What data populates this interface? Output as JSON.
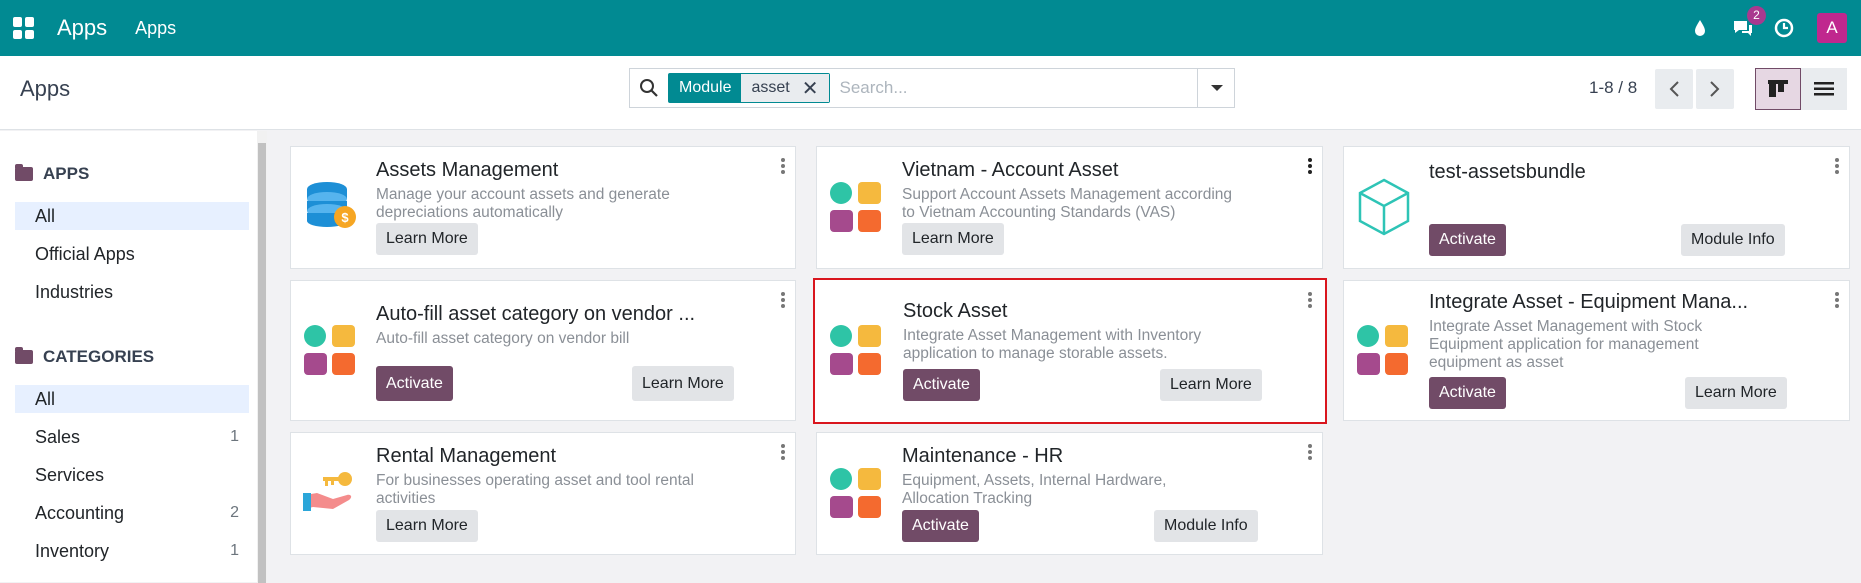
{
  "topbar": {
    "title": "Apps",
    "menu": "Apps",
    "chat_badge": "2",
    "avatar_letter": "A"
  },
  "control": {
    "page_title": "Apps",
    "facet_key": "Module",
    "facet_value": "asset",
    "search_placeholder": "Search...",
    "pager": "1-8 / 8"
  },
  "sidebar": {
    "apps_header": "APPS",
    "apps_items": [
      {
        "label": "All"
      },
      {
        "label": "Official Apps"
      },
      {
        "label": "Industries"
      }
    ],
    "categories_header": "CATEGORIES",
    "category_items": [
      {
        "label": "All",
        "count": ""
      },
      {
        "label": "Sales",
        "count": "1"
      },
      {
        "label": "Services",
        "count": ""
      },
      {
        "label": "Accounting",
        "count": "2"
      },
      {
        "label": "Inventory",
        "count": "1"
      }
    ]
  },
  "cards": [
    {
      "title": "Assets Management",
      "desc": "Manage your account assets and generate depreciations automatically",
      "btn1": "Learn More",
      "btn2": ""
    },
    {
      "title": "Vietnam - Account Asset",
      "desc": "Support Account Assets Management according to Vietnam Accounting Standards (VAS)",
      "btn1": "Learn More",
      "btn2": ""
    },
    {
      "title": "test-assetsbundle",
      "desc": "",
      "btn1": "Activate",
      "btn2": "Module Info"
    },
    {
      "title": "Auto-fill asset category on vendor ...",
      "desc": "Auto-fill asset category on vendor bill",
      "btn1": "Activate",
      "btn2": "Learn More"
    },
    {
      "title": "Stock Asset",
      "desc": "Integrate Asset Management with Inventory application to manage storable assets.",
      "btn1": "Activate",
      "btn2": "Learn More"
    },
    {
      "title": "Integrate Asset - Equipment Mana...",
      "desc": "Integrate Asset Management with Stock Equipment application for management equipment as asset",
      "btn1": "Activate",
      "btn2": "Learn More"
    },
    {
      "title": "Rental Management",
      "desc": "For businesses operating asset and tool rental activities",
      "btn1": "Learn More",
      "btn2": ""
    },
    {
      "title": "Maintenance - HR",
      "desc": "Equipment, Assets, Internal Hardware, Allocation Tracking",
      "btn1": "Activate",
      "btn2": "Module Info"
    }
  ],
  "colors": {
    "brand": "#018a92",
    "primary": "#714b67",
    "selected_border": "#d9161e"
  }
}
